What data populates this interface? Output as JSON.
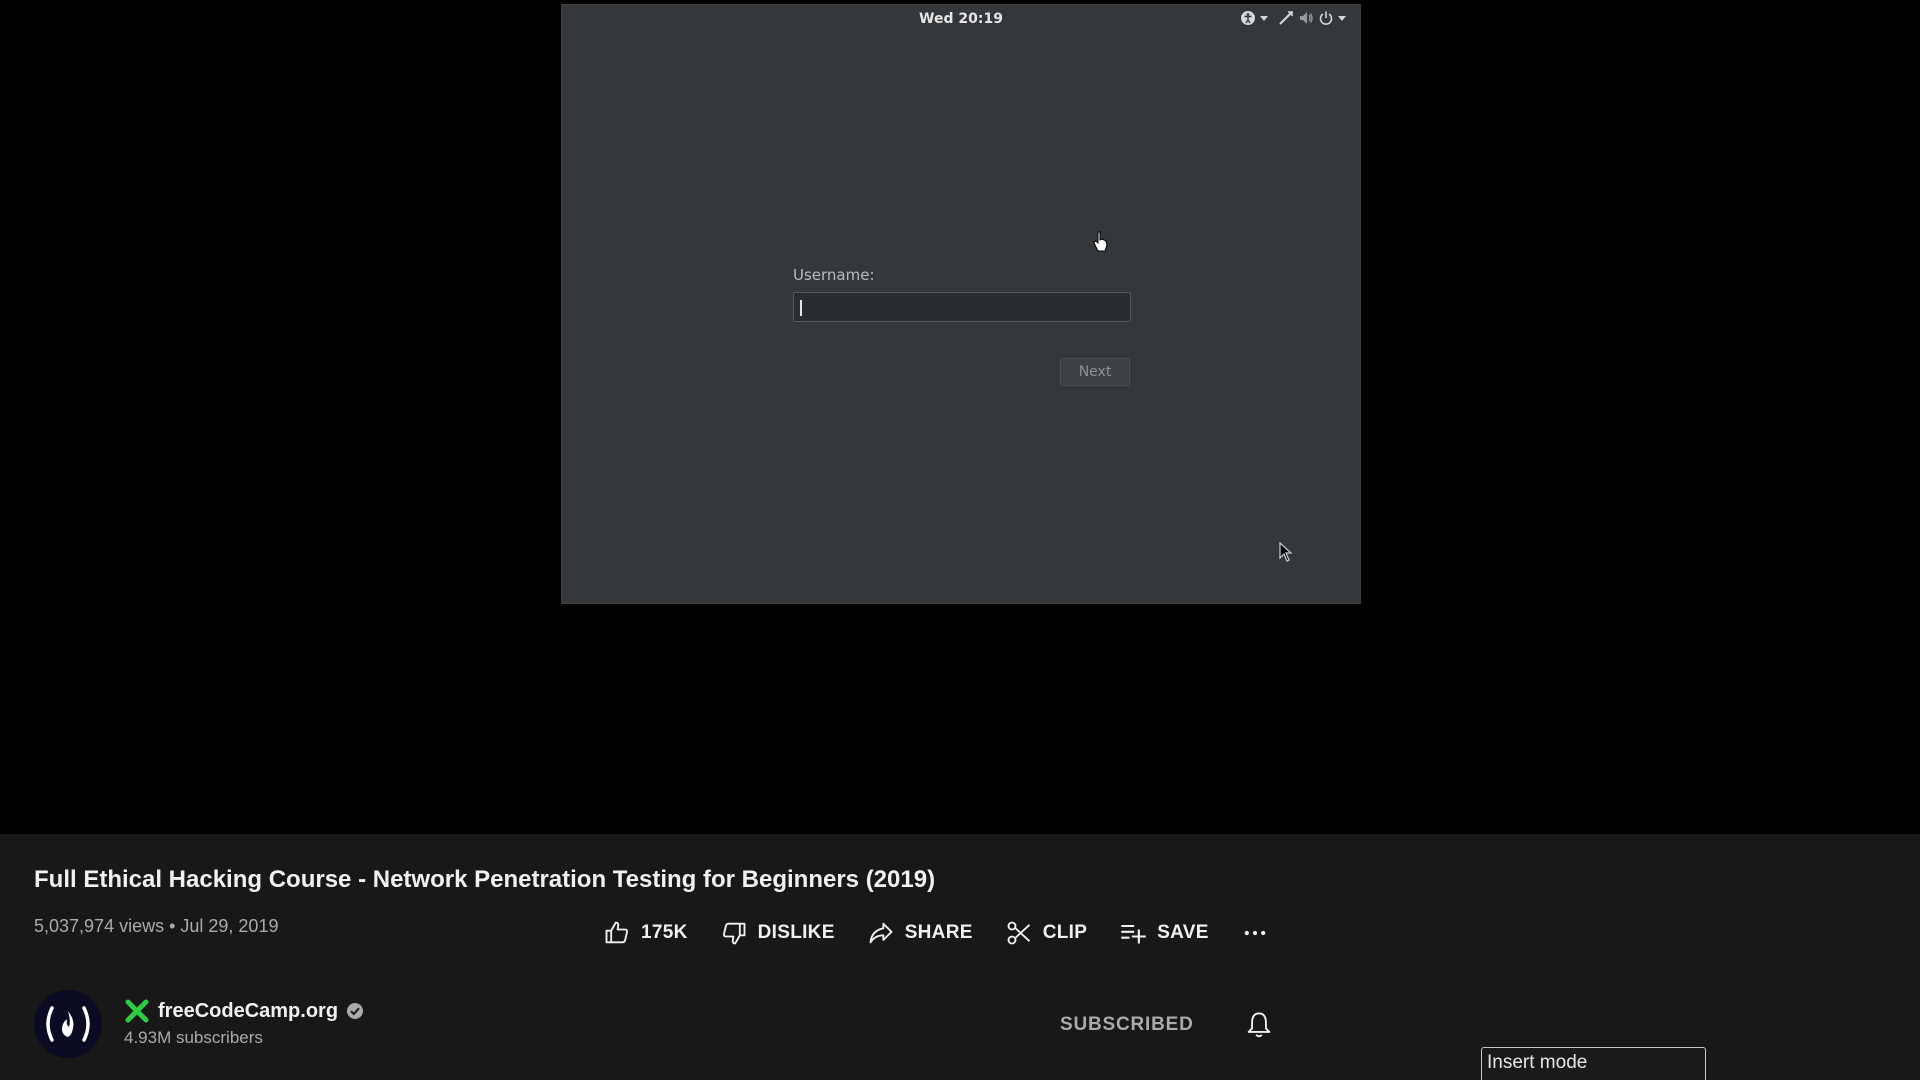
{
  "vm": {
    "clock": "Wed 20:19",
    "username_label": "Username:",
    "username_value": "",
    "next_label": "Next",
    "tray_icons": [
      "accessibility-icon",
      "network-icon",
      "volume-icon",
      "power-icon"
    ]
  },
  "video": {
    "title": "Full Ethical Hacking Course - Network Penetration Testing for Beginners (2019)",
    "stats": "5,037,974 views • Jul 29, 2019"
  },
  "actions": {
    "like_label": "175K",
    "dislike_label": "DISLIKE",
    "share_label": "SHARE",
    "clip_label": "CLIP",
    "save_label": "SAVE",
    "more_label": "•••"
  },
  "channel": {
    "name": "freeCodeCamp.org",
    "subscribers": "4.93M subscribers",
    "avatar_text": "(🔥)",
    "subscribed_label": "SUBSCRIBED"
  },
  "overlay": {
    "insert_mode": "Insert mode"
  },
  "colors": {
    "vm_background": "#34383b",
    "page_background": "#181818",
    "verified_green": "#2ecc40"
  }
}
